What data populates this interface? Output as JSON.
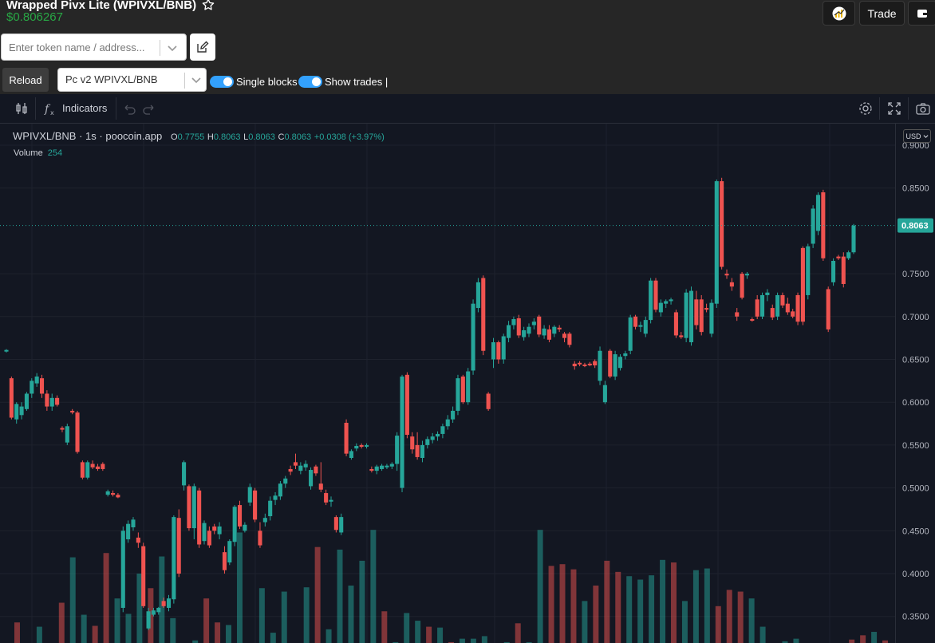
{
  "header": {
    "token_title": "Wrapped Pivx Lite (WPIVXL/BNB)",
    "price": "$0.806267",
    "trade_label": "Trade",
    "search_placeholder": "Enter token name / address...",
    "reload_label": "Reload",
    "pair_selected": "Pc v2 WPIVXL/BNB",
    "single_blocks_label": "Single blocks",
    "show_trades_label": "Show trades |",
    "colors": {
      "accent": "#33a1fd",
      "price_green": "#28a745"
    }
  },
  "toolbar": {
    "indicators_label": "Indicators",
    "icons": [
      "compare-icon",
      "fx-icon",
      "undo-icon",
      "redo-icon",
      "settings-icon",
      "fullscreen-icon",
      "camera-icon"
    ]
  },
  "legend": {
    "symbol": "WPIVXL/BNB",
    "interval": "1s",
    "source": "poocoin.app",
    "o_label": "O",
    "o_value": "0.7755",
    "h_label": "H",
    "h_value": "0.8063",
    "l_label": "L",
    "l_value": "0.8063",
    "c_label": "C",
    "c_value": "0.8063",
    "change": "+0.0308 (+3.97%)",
    "volume_label": "Volume",
    "volume_value": "254",
    "currency": "USD"
  },
  "chart_data": {
    "type": "candlestick",
    "y_ticks": [
      "0.9000",
      "0.8500",
      "0.8063",
      "0.7500",
      "0.7000",
      "0.6500",
      "0.6000",
      "0.5500",
      "0.5000",
      "0.4500",
      "0.4000",
      "0.3500"
    ],
    "ylim": [
      0.33,
      0.9
    ],
    "last_price": 0.8063,
    "colors": {
      "up": "#26a69a",
      "down": "#ef5350"
    },
    "candles": [
      [
        0.66,
        0.662,
        0.658,
        0.661
      ],
      [
        0.628,
        0.63,
        0.58,
        0.582
      ],
      [
        0.58,
        0.6,
        0.575,
        0.598
      ],
      [
        0.585,
        0.6,
        0.58,
        0.595
      ],
      [
        0.592,
        0.612,
        0.59,
        0.61
      ],
      [
        0.61,
        0.628,
        0.605,
        0.625
      ],
      [
        0.622,
        0.634,
        0.618,
        0.63
      ],
      [
        0.628,
        0.632,
        0.605,
        0.61
      ],
      [
        0.61,
        0.614,
        0.59,
        0.595
      ],
      [
        0.595,
        0.61,
        0.59,
        0.605
      ],
      [
        0.605,
        0.608,
        0.595,
        0.597
      ],
      [
        0.57,
        0.572,
        0.565,
        0.568
      ],
      [
        0.553,
        0.575,
        0.55,
        0.572
      ],
      [
        0.59,
        0.592,
        0.586,
        0.588
      ],
      [
        0.588,
        0.59,
        0.54,
        0.542
      ],
      [
        0.53,
        0.532,
        0.51,
        0.512
      ],
      [
        0.512,
        0.532,
        0.51,
        0.53
      ],
      [
        0.528,
        0.532,
        0.522,
        0.524
      ],
      [
        0.525,
        0.528,
        0.52,
        0.522
      ],
      [
        0.528,
        0.53,
        0.52,
        0.522
      ],
      [
        0.492,
        0.498,
        0.49,
        0.496
      ],
      [
        0.494,
        0.497,
        0.49,
        0.492
      ],
      [
        0.492,
        0.494,
        0.488,
        0.489
      ],
      [
        0.36,
        0.455,
        0.355,
        0.45
      ],
      [
        0.44,
        0.462,
        0.436,
        0.458
      ],
      [
        0.454,
        0.466,
        0.45,
        0.463
      ],
      [
        0.442,
        0.448,
        0.43,
        0.436
      ],
      [
        0.432,
        0.436,
        0.36,
        0.362
      ],
      [
        0.336,
        0.36,
        0.334,
        0.356
      ],
      [
        0.352,
        0.36,
        0.35,
        0.357
      ],
      [
        0.355,
        0.361,
        0.352,
        0.36
      ],
      [
        0.368,
        0.372,
        0.36,
        0.362
      ],
      [
        0.36,
        0.375,
        0.356,
        0.371
      ],
      [
        0.37,
        0.468,
        0.365,
        0.466
      ],
      [
        0.465,
        0.475,
        0.396,
        0.4
      ],
      [
        0.503,
        0.532,
        0.497,
        0.53
      ],
      [
        0.502,
        0.504,
        0.45,
        0.453
      ],
      [
        0.453,
        0.505,
        0.44,
        0.502
      ],
      [
        0.497,
        0.5,
        0.43,
        0.434
      ],
      [
        0.438,
        0.462,
        0.434,
        0.459
      ],
      [
        0.45,
        0.455,
        0.43,
        0.433
      ],
      [
        0.455,
        0.458,
        0.446,
        0.45
      ],
      [
        0.446,
        0.46,
        0.44,
        0.455
      ],
      [
        0.425,
        0.432,
        0.4,
        0.404
      ],
      [
        0.413,
        0.44,
        0.41,
        0.438
      ],
      [
        0.437,
        0.48,
        0.432,
        0.478
      ],
      [
        0.48,
        0.485,
        0.452,
        0.455
      ],
      [
        0.45,
        0.46,
        0.448,
        0.457
      ],
      [
        0.483,
        0.505,
        0.479,
        0.501
      ],
      [
        0.497,
        0.5,
        0.46,
        0.463
      ],
      [
        0.45,
        0.46,
        0.43,
        0.433
      ],
      [
        0.46,
        0.47,
        0.455,
        0.465
      ],
      [
        0.467,
        0.49,
        0.462,
        0.485
      ],
      [
        0.486,
        0.495,
        0.48,
        0.491
      ],
      [
        0.49,
        0.508,
        0.486,
        0.505
      ],
      [
        0.505,
        0.514,
        0.5,
        0.511
      ],
      [
        0.522,
        0.526,
        0.515,
        0.519
      ],
      [
        0.53,
        0.54,
        0.522,
        0.526
      ],
      [
        0.52,
        0.53,
        0.516,
        0.526
      ],
      [
        0.524,
        0.532,
        0.52,
        0.528
      ],
      [
        0.502,
        0.524,
        0.498,
        0.521
      ],
      [
        0.525,
        0.527,
        0.514,
        0.517
      ],
      [
        0.505,
        0.53,
        0.495,
        0.498
      ],
      [
        0.494,
        0.498,
        0.48,
        0.483
      ],
      [
        0.484,
        0.49,
        0.478,
        0.486
      ],
      [
        0.466,
        0.468,
        0.448,
        0.451
      ],
      [
        0.448,
        0.47,
        0.445,
        0.466
      ],
      [
        0.576,
        0.58,
        0.537,
        0.54
      ],
      [
        0.535,
        0.545,
        0.533,
        0.543
      ],
      [
        0.546,
        0.552,
        0.543,
        0.549
      ],
      [
        0.55,
        0.552,
        0.546,
        0.548
      ],
      [
        0.548,
        0.552,
        0.546,
        0.55
      ],
      [
        0.522,
        0.525,
        0.518,
        0.52
      ],
      [
        0.52,
        0.527,
        0.516,
        0.525
      ],
      [
        0.522,
        0.528,
        0.52,
        0.526
      ],
      [
        0.524,
        0.528,
        0.522,
        0.526
      ],
      [
        0.525,
        0.53,
        0.522,
        0.528
      ],
      [
        0.528,
        0.565,
        0.52,
        0.561
      ],
      [
        0.5,
        0.632,
        0.495,
        0.63
      ],
      [
        0.632,
        0.635,
        0.558,
        0.562
      ],
      [
        0.56,
        0.565,
        0.54,
        0.545
      ],
      [
        0.55,
        0.565,
        0.533,
        0.536
      ],
      [
        0.535,
        0.555,
        0.53,
        0.55
      ],
      [
        0.55,
        0.56,
        0.546,
        0.557
      ],
      [
        0.556,
        0.564,
        0.552,
        0.56
      ],
      [
        0.56,
        0.566,
        0.555,
        0.563
      ],
      [
        0.563,
        0.575,
        0.558,
        0.572
      ],
      [
        0.572,
        0.585,
        0.568,
        0.58
      ],
      [
        0.58,
        0.595,
        0.576,
        0.59
      ],
      [
        0.59,
        0.632,
        0.585,
        0.628
      ],
      [
        0.63,
        0.632,
        0.598,
        0.6
      ],
      [
        0.6,
        0.64,
        0.597,
        0.636
      ],
      [
        0.637,
        0.72,
        0.632,
        0.715
      ],
      [
        0.71,
        0.745,
        0.705,
        0.74
      ],
      [
        0.745,
        0.748,
        0.655,
        0.66
      ],
      [
        0.61,
        0.612,
        0.59,
        0.592
      ],
      [
        0.65,
        0.675,
        0.64,
        0.67
      ],
      [
        0.67,
        0.672,
        0.645,
        0.65
      ],
      [
        0.65,
        0.68,
        0.645,
        0.677
      ],
      [
        0.675,
        0.695,
        0.67,
        0.69
      ],
      [
        0.69,
        0.7,
        0.685,
        0.697
      ],
      [
        0.698,
        0.702,
        0.675,
        0.678
      ],
      [
        0.676,
        0.688,
        0.672,
        0.684
      ],
      [
        0.68,
        0.692,
        0.676,
        0.688
      ],
      [
        0.69,
        0.698,
        0.685,
        0.694
      ],
      [
        0.7,
        0.702,
        0.676,
        0.679
      ],
      [
        0.678,
        0.69,
        0.674,
        0.686
      ],
      [
        0.685,
        0.69,
        0.67,
        0.673
      ],
      [
        0.68,
        0.69,
        0.676,
        0.688
      ],
      [
        0.687,
        0.69,
        0.682,
        0.685
      ],
      [
        0.68,
        0.682,
        0.67,
        0.675
      ],
      [
        0.68,
        0.682,
        0.664,
        0.667
      ],
      [
        0.645,
        0.648,
        0.638,
        0.642
      ],
      [
        0.646,
        0.648,
        0.642,
        0.645
      ],
      [
        0.644,
        0.646,
        0.641,
        0.643
      ],
      [
        0.645,
        0.647,
        0.642,
        0.644
      ],
      [
        0.648,
        0.65,
        0.64,
        0.643
      ],
      [
        0.625,
        0.665,
        0.62,
        0.66
      ],
      [
        0.6,
        0.625,
        0.598,
        0.62
      ],
      [
        0.66,
        0.662,
        0.628,
        0.63
      ],
      [
        0.63,
        0.66,
        0.626,
        0.656
      ],
      [
        0.64,
        0.656,
        0.637,
        0.653
      ],
      [
        0.654,
        0.66,
        0.65,
        0.657
      ],
      [
        0.66,
        0.702,
        0.656,
        0.699
      ],
      [
        0.7,
        0.702,
        0.685,
        0.688
      ],
      [
        0.688,
        0.694,
        0.682,
        0.69
      ],
      [
        0.68,
        0.7,
        0.676,
        0.696
      ],
      [
        0.696,
        0.745,
        0.692,
        0.742
      ],
      [
        0.742,
        0.745,
        0.705,
        0.708
      ],
      [
        0.705,
        0.72,
        0.7,
        0.716
      ],
      [
        0.715,
        0.72,
        0.71,
        0.718
      ],
      [
        0.718,
        0.722,
        0.714,
        0.72
      ],
      [
        0.705,
        0.708,
        0.675,
        0.678
      ],
      [
        0.678,
        0.682,
        0.674,
        0.676
      ],
      [
        0.675,
        0.732,
        0.67,
        0.728
      ],
      [
        0.67,
        0.735,
        0.666,
        0.73
      ],
      [
        0.72,
        0.73,
        0.685,
        0.69
      ],
      [
        0.72,
        0.725,
        0.678,
        0.682
      ],
      [
        0.71,
        0.715,
        0.705,
        0.708
      ],
      [
        0.68,
        0.72,
        0.676,
        0.716
      ],
      [
        0.715,
        0.86,
        0.71,
        0.858
      ],
      [
        0.858,
        0.862,
        0.755,
        0.758
      ],
      [
        0.75,
        0.755,
        0.744,
        0.748
      ],
      [
        0.74,
        0.745,
        0.73,
        0.735
      ],
      [
        0.705,
        0.71,
        0.695,
        0.7
      ],
      [
        0.75,
        0.752,
        0.72,
        0.722
      ],
      [
        0.748,
        0.752,
        0.744,
        0.75
      ],
      [
        0.697,
        0.699,
        0.694,
        0.696
      ],
      [
        0.72,
        0.725,
        0.697,
        0.7
      ],
      [
        0.7,
        0.728,
        0.697,
        0.725
      ],
      [
        0.725,
        0.732,
        0.718,
        0.728
      ],
      [
        0.71,
        0.714,
        0.696,
        0.699
      ],
      [
        0.7,
        0.728,
        0.696,
        0.725
      ],
      [
        0.725,
        0.728,
        0.71,
        0.713
      ],
      [
        0.715,
        0.722,
        0.702,
        0.705
      ],
      [
        0.706,
        0.709,
        0.698,
        0.7
      ],
      [
        0.725,
        0.728,
        0.69,
        0.694
      ],
      [
        0.78,
        0.782,
        0.69,
        0.694
      ],
      [
        0.725,
        0.785,
        0.72,
        0.782
      ],
      [
        0.785,
        0.83,
        0.78,
        0.826
      ],
      [
        0.8,
        0.845,
        0.795,
        0.842
      ],
      [
        0.845,
        0.848,
        0.765,
        0.768
      ],
      [
        0.732,
        0.735,
        0.682,
        0.685
      ],
      [
        0.74,
        0.768,
        0.736,
        0.765
      ],
      [
        0.77,
        0.772,
        0.766,
        0.768
      ],
      [
        0.77,
        0.775,
        0.734,
        0.738
      ],
      [
        0.768,
        0.777,
        0.766,
        0.775
      ],
      [
        0.775,
        0.808,
        0.773,
        0.8063
      ]
    ],
    "volumes": [
      [
        0.343,
        "down"
      ],
      [
        0.306,
        "down"
      ],
      [
        0.338,
        "up"
      ],
      [
        0.311,
        "up"
      ],
      [
        0.366,
        "down"
      ],
      [
        0.419,
        "up"
      ],
      [
        0.352,
        "up"
      ],
      [
        0.339,
        "down"
      ],
      [
        0.424,
        "down"
      ],
      [
        0.371,
        "up"
      ],
      [
        0.353,
        "up"
      ],
      [
        0.4,
        "up"
      ],
      [
        0.383,
        "down"
      ],
      [
        0.42,
        "up"
      ],
      [
        0.348,
        "up"
      ],
      [
        0.31,
        "down"
      ],
      [
        0.322,
        "up"
      ],
      [
        0.371,
        "down"
      ],
      [
        0.343,
        "down"
      ],
      [
        0.34,
        "up"
      ],
      [
        0.448,
        "up"
      ],
      [
        0.309,
        "up"
      ],
      [
        0.383,
        "up"
      ],
      [
        0.331,
        "up"
      ],
      [
        0.379,
        "up"
      ],
      [
        0.311,
        "up"
      ],
      [
        0.384,
        "up"
      ],
      [
        0.431,
        "down"
      ],
      [
        0.335,
        "up"
      ],
      [
        0.428,
        "up"
      ],
      [
        0.386,
        "up"
      ],
      [
        0.415,
        "up"
      ],
      [
        0.451,
        "up"
      ],
      [
        0.356,
        "down"
      ],
      [
        0.32,
        "up"
      ],
      [
        0.354,
        "up"
      ],
      [
        0.345,
        "up"
      ],
      [
        0.338,
        "down"
      ],
      [
        0.337,
        "up"
      ],
      [
        0.32,
        "down"
      ],
      [
        0.324,
        "up"
      ],
      [
        0.324,
        "up"
      ],
      [
        0.327,
        "up"
      ],
      [
        0.314,
        "up"
      ],
      [
        0.32,
        "up"
      ],
      [
        0.342,
        "down"
      ],
      [
        0.32,
        "up"
      ],
      [
        0.451,
        "up"
      ],
      [
        0.409,
        "down"
      ],
      [
        0.411,
        "down"
      ],
      [
        0.405,
        "down"
      ],
      [
        0.368,
        "up"
      ],
      [
        0.386,
        "down"
      ],
      [
        0.415,
        "down"
      ],
      [
        0.402,
        "down"
      ],
      [
        0.397,
        "up"
      ],
      [
        0.393,
        "up"
      ],
      [
        0.398,
        "up"
      ],
      [
        0.416,
        "up"
      ],
      [
        0.413,
        "down"
      ],
      [
        0.368,
        "up"
      ],
      [
        0.404,
        "up"
      ],
      [
        0.406,
        "up"
      ],
      [
        0.362,
        "down"
      ],
      [
        0.381,
        "down"
      ],
      [
        0.379,
        "down"
      ],
      [
        0.371,
        "up"
      ],
      [
        0.338,
        "up"
      ],
      [
        0.319,
        "down"
      ],
      [
        0.321,
        "up"
      ],
      [
        0.324,
        "up"
      ],
      [
        0.316,
        "up"
      ],
      [
        0.31,
        "down"
      ],
      [
        0.303,
        "up"
      ],
      [
        0.318,
        "up"
      ],
      [
        0.323,
        "down"
      ],
      [
        0.328,
        "down"
      ],
      [
        0.332,
        "up"
      ],
      [
        0.322,
        "down"
      ]
    ]
  }
}
